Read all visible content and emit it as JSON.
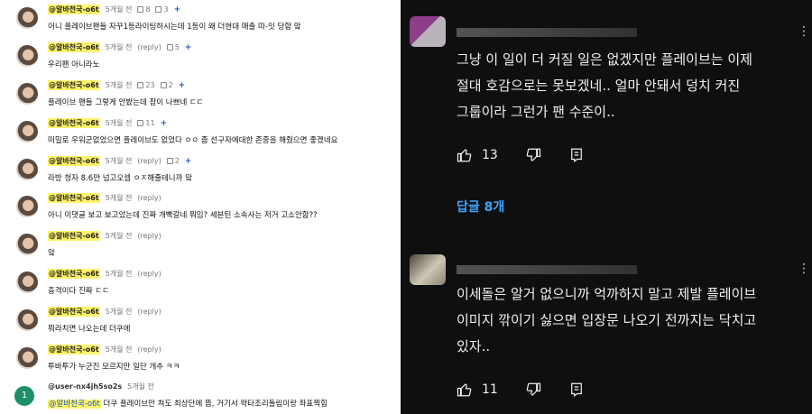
{
  "left_comments": [
    {
      "author": "@알바천국-o6t",
      "time": "5개월 전",
      "likes": "8",
      "replies": "3",
      "text": "어니 플레이브팬들 자꾸1등라이팅하시는데 1등이 왜 더현대 매출 따-잇 당함 앜"
    },
    {
      "author": "@알바천국-o6t",
      "time": "5개월 전",
      "reply": "(reply)",
      "likes": "5",
      "text": "우리팬 아니라노"
    },
    {
      "author": "@알바천국-o6t",
      "time": "5개월 전",
      "likes": "23",
      "replies": "2",
      "text": "플레이브 팬들 그렇게 안봤는데 참이 나쁘네 ㄷㄷ"
    },
    {
      "author": "@알바천국-o6t",
      "time": "5개월 전",
      "likes": "11",
      "text": "떠밀로 우워군없었으면 플레이브도 없었다 ㅇㅇ 좀 선구자에대한 존중을 해줬으면 좋겠네요"
    },
    {
      "author": "@알바천국-o6t",
      "time": "5개월 전",
      "likes": "2",
      "reply": "(reply)",
      "text": "라방 청자 8.6만 넘고오셈 ㅇㅈ해줄테니까 앜"
    },
    {
      "author": "@알바천국-o6t",
      "time": "5개월 전",
      "reply": "(reply)",
      "text": "아니 이댓글 보고 보고았는데 진짜 개빡갈네 뭐임? 세븐틴 소속사는 저거 고소안함??"
    },
    {
      "author": "@알바천국-o6t",
      "time": "5개월 전",
      "reply": "(reply)",
      "text": "앜"
    },
    {
      "author": "@알바천국-o6t",
      "time": "5개월 전",
      "reply": "(reply)",
      "text": "충격이다 진짜 ㄷㄷ"
    },
    {
      "author": "@알바천국-o6t",
      "time": "5개월 전",
      "reply": "(reply)",
      "text": "뭐라치면 나오는데 더쿠에"
    },
    {
      "author": "@알바천국-o6t",
      "time": "5개월 전",
      "reply": "(reply)",
      "text": "투바투가 누군진 모르지만 일단 개추 ㅋㅋ"
    }
  ],
  "special_comment": {
    "avatar_letter": "1",
    "author": "@user-nx4jh5so2s",
    "time": "5개월 전",
    "mention": "@알바천국-o6t",
    "text": " 더쿠 플레이브만 쳐도 최상단에 뜸, 거기서 왁타조리돌림이랑 좌표찍힘"
  },
  "right_comments": [
    {
      "lines": [
        "그냥 이 일이 더 커질 일은 없겠지만 플레이브는 이제",
        "절대 호감으로는 못보겠네.. 얼마 안돼서 덩치 커진",
        "그룹이라 그런가 팬 수준이.."
      ],
      "likes": "13"
    },
    {
      "lines": [
        "이세돌은 알거 없으니까 억까하지 말고 제발 플레이브",
        "이미지 깎이기 싫으면 입장문 나오기 전까지는 닥치고",
        "있자.."
      ],
      "likes": "11"
    }
  ],
  "replies_label": "답글 8개",
  "colors": {
    "highlight": "#fff36b",
    "link_blue": "#3ea6ff",
    "dark_bg": "#0f0f0f"
  }
}
